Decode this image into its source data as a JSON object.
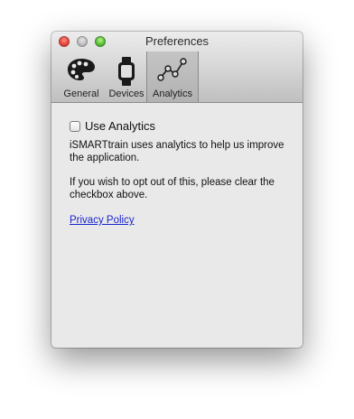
{
  "window": {
    "title": "Preferences"
  },
  "toolbar": {
    "tabs": [
      {
        "label": "General",
        "icon": "palette-icon"
      },
      {
        "label": "Devices",
        "icon": "watch-icon"
      },
      {
        "label": "Analytics",
        "icon": "line-graph-icon",
        "selected": true
      }
    ]
  },
  "content": {
    "checkbox_label": "Use Analytics",
    "checkbox_checked": false,
    "description": "iSMARTtrain uses analytics to help us improve the application.",
    "opt_out_text": "If you wish to opt out of this, please clear the checkbox above.",
    "privacy_link": "Privacy Policy"
  },
  "colors": {
    "link": "#1a24cc",
    "close_button": "#e8463c",
    "zoom_button": "#5dc23a"
  }
}
